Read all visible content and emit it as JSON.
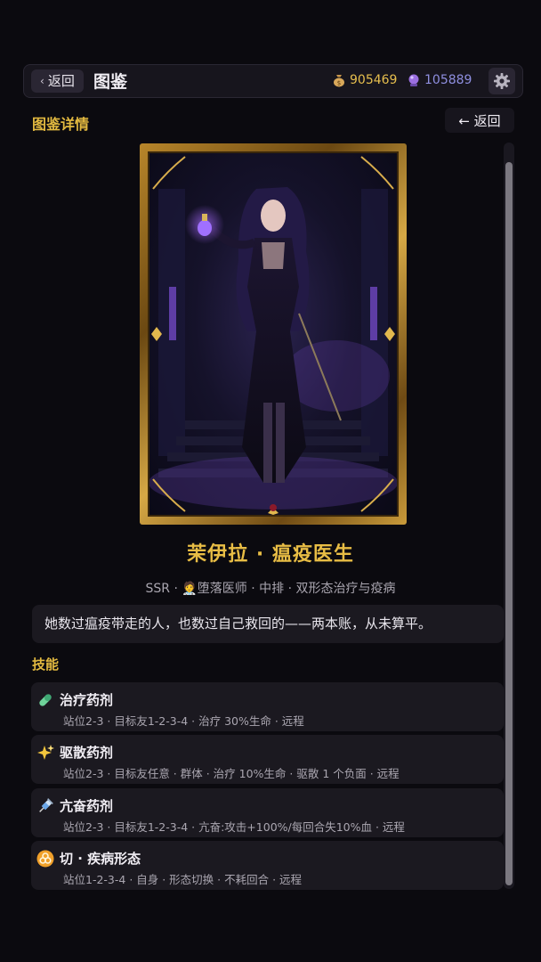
{
  "header": {
    "back_label": "返回",
    "title": "图鉴",
    "gold": "905469",
    "gems": "105889",
    "gold_icon": "money-bag-icon",
    "gem_icon": "crystal-ball-icon",
    "settings_icon": "gear-icon"
  },
  "detail": {
    "section_title": "图鉴详情",
    "back_label": "← 返回"
  },
  "hero": {
    "name": "茉伊拉 · 瘟疫医生",
    "tags": "SSR · 🧑‍⚕️堕落医师 · 中排 · 双形态治疗与疫病",
    "tags_parts": [
      "SSR",
      "堕落医师",
      "中排",
      "双形态治疗与疫病"
    ],
    "quote": "她数过瘟疫带走的人，也数过自己救回的——两本账，从未算平。"
  },
  "skills": {
    "title": "技能",
    "items": [
      {
        "name": "治疗药剂",
        "desc": "站位2-3 · 目标友1-2-3-4 · 治疗 30%生命 · 远程",
        "icon": "green-pill-icon"
      },
      {
        "name": "驱散药剂",
        "desc": "站位2-3 · 目标友任意 · 群体 · 治疗 10%生命 · 驱散 1 个负面 · 远程",
        "icon": "sparkles-icon"
      },
      {
        "name": "亢奋药剂",
        "desc": "站位2-3 · 目标友1-2-3-4 · 亢奋:攻击+100%/每回合失10%血 · 远程",
        "icon": "syringe-icon"
      },
      {
        "name": "切 · 疾病形态",
        "desc": "站位1-2-3-4 · 自身 · 形态切换 · 不耗回合 · 远程",
        "icon": "biohazard-icon"
      }
    ]
  },
  "colors": {
    "accent_gold": "#e2b940",
    "background": "#0b0a0f",
    "panel": "#1b1920"
  }
}
